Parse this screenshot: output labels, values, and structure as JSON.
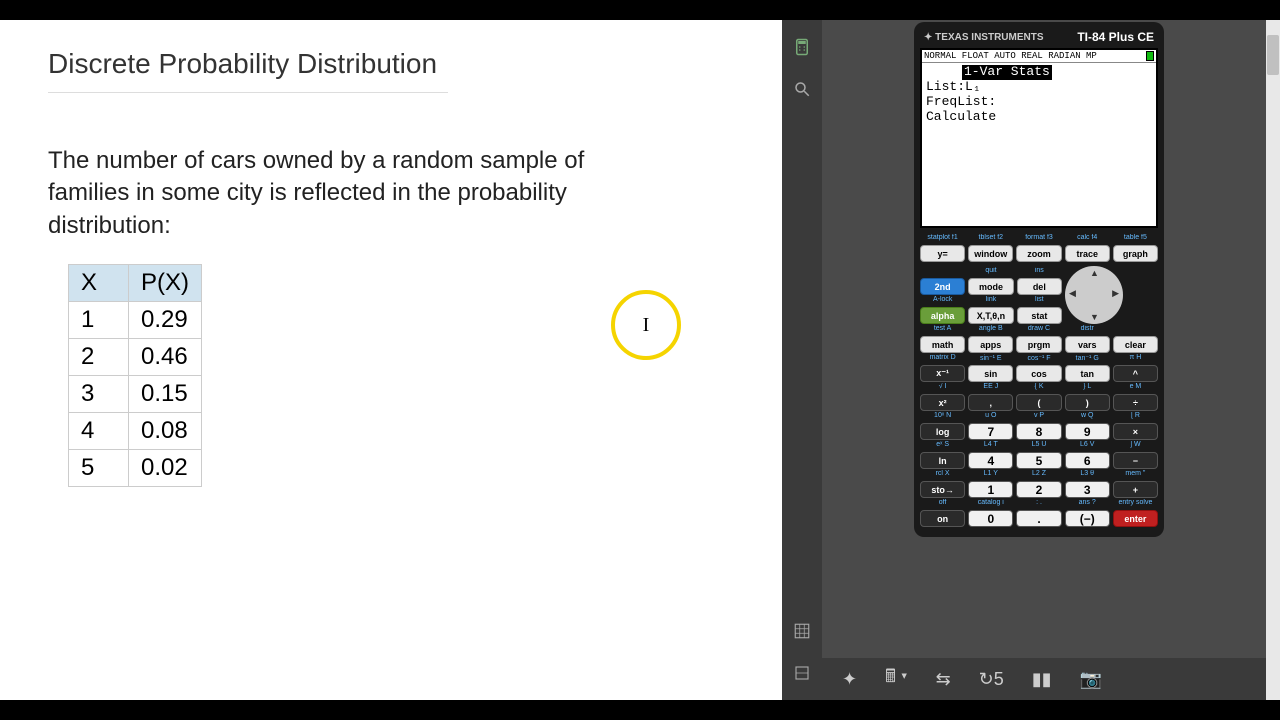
{
  "doc": {
    "title": "Discrete Probability Distribution",
    "body": "The number of cars owned by a random sample of families in some city is reflected in the probability distribution:",
    "table": {
      "headers": [
        "X",
        "P(X)"
      ],
      "rows": [
        {
          "x": "1",
          "p": "0.29"
        },
        {
          "x": "2",
          "p": "0.46"
        },
        {
          "x": "3",
          "p": "0.15"
        },
        {
          "x": "4",
          "p": "0.08"
        },
        {
          "x": "5",
          "p": "0.02"
        }
      ]
    },
    "cursor_char": "I"
  },
  "calc": {
    "brand": "TEXAS INSTRUMENTS",
    "model": "TI-84 Plus CE",
    "status": "NORMAL FLOAT AUTO REAL RADIAN MP",
    "screen": {
      "title": "1-Var Stats",
      "lines": [
        "List:L₁",
        "FreqList:",
        "Calculate"
      ]
    },
    "sec_labels": {
      "r0": [
        "statplot f1",
        "tblset f2",
        "format f3",
        "calc f4",
        "table f5"
      ],
      "r1": [
        "",
        "quit",
        "",
        "ins",
        ""
      ],
      "r1g": [
        "",
        "",
        "",
        "",
        ""
      ],
      "r2": [
        "A-lock",
        "link",
        "",
        "list",
        ""
      ],
      "r3": [
        "test A",
        "angle B",
        "draw C",
        "distr",
        ""
      ],
      "r4": [
        "matrix D",
        "sin⁻¹ E",
        "cos⁻¹ F",
        "tan⁻¹ G",
        "π H"
      ],
      "r5": [
        "√ I",
        "EE J",
        "{ K",
        "} L",
        "e M"
      ],
      "r6": [
        "10ˣ N",
        "u O",
        "v P",
        "w Q",
        "[ R"
      ],
      "r7": [
        "eˣ S",
        "L4 T",
        "L5 U",
        "L6 V",
        "] W"
      ],
      "r8": [
        "rcl X",
        "L1 Y",
        "L2 Z",
        "L3 θ",
        "mem \""
      ],
      "r9": [
        "off",
        "catalog i",
        ": .",
        "ans ?",
        "entry solve"
      ]
    },
    "keys": {
      "r0": [
        "y=",
        "window",
        "zoom",
        "trace",
        "graph"
      ],
      "r1": [
        "2nd",
        "mode",
        "del"
      ],
      "r2": [
        "alpha",
        "X,T,θ,n",
        "stat"
      ],
      "r3": [
        "math",
        "apps",
        "prgm",
        "vars",
        "clear"
      ],
      "r4": [
        "x⁻¹",
        "sin",
        "cos",
        "tan",
        "^"
      ],
      "r5": [
        "x²",
        ",",
        "(",
        ")",
        "÷"
      ],
      "r6": [
        "log",
        "7",
        "8",
        "9",
        "×"
      ],
      "r7": [
        "ln",
        "4",
        "5",
        "6",
        "−"
      ],
      "r8": [
        "sto→",
        "1",
        "2",
        "3",
        "+"
      ],
      "r9": [
        "on",
        "0",
        ".",
        "(−)",
        "enter"
      ]
    }
  },
  "chart_data": {
    "type": "table",
    "title": "Discrete Probability Distribution",
    "headers": [
      "X",
      "P(X)"
    ],
    "rows": [
      [
        1,
        0.29
      ],
      [
        2,
        0.46
      ],
      [
        3,
        0.15
      ],
      [
        4,
        0.08
      ],
      [
        5,
        0.02
      ]
    ]
  }
}
